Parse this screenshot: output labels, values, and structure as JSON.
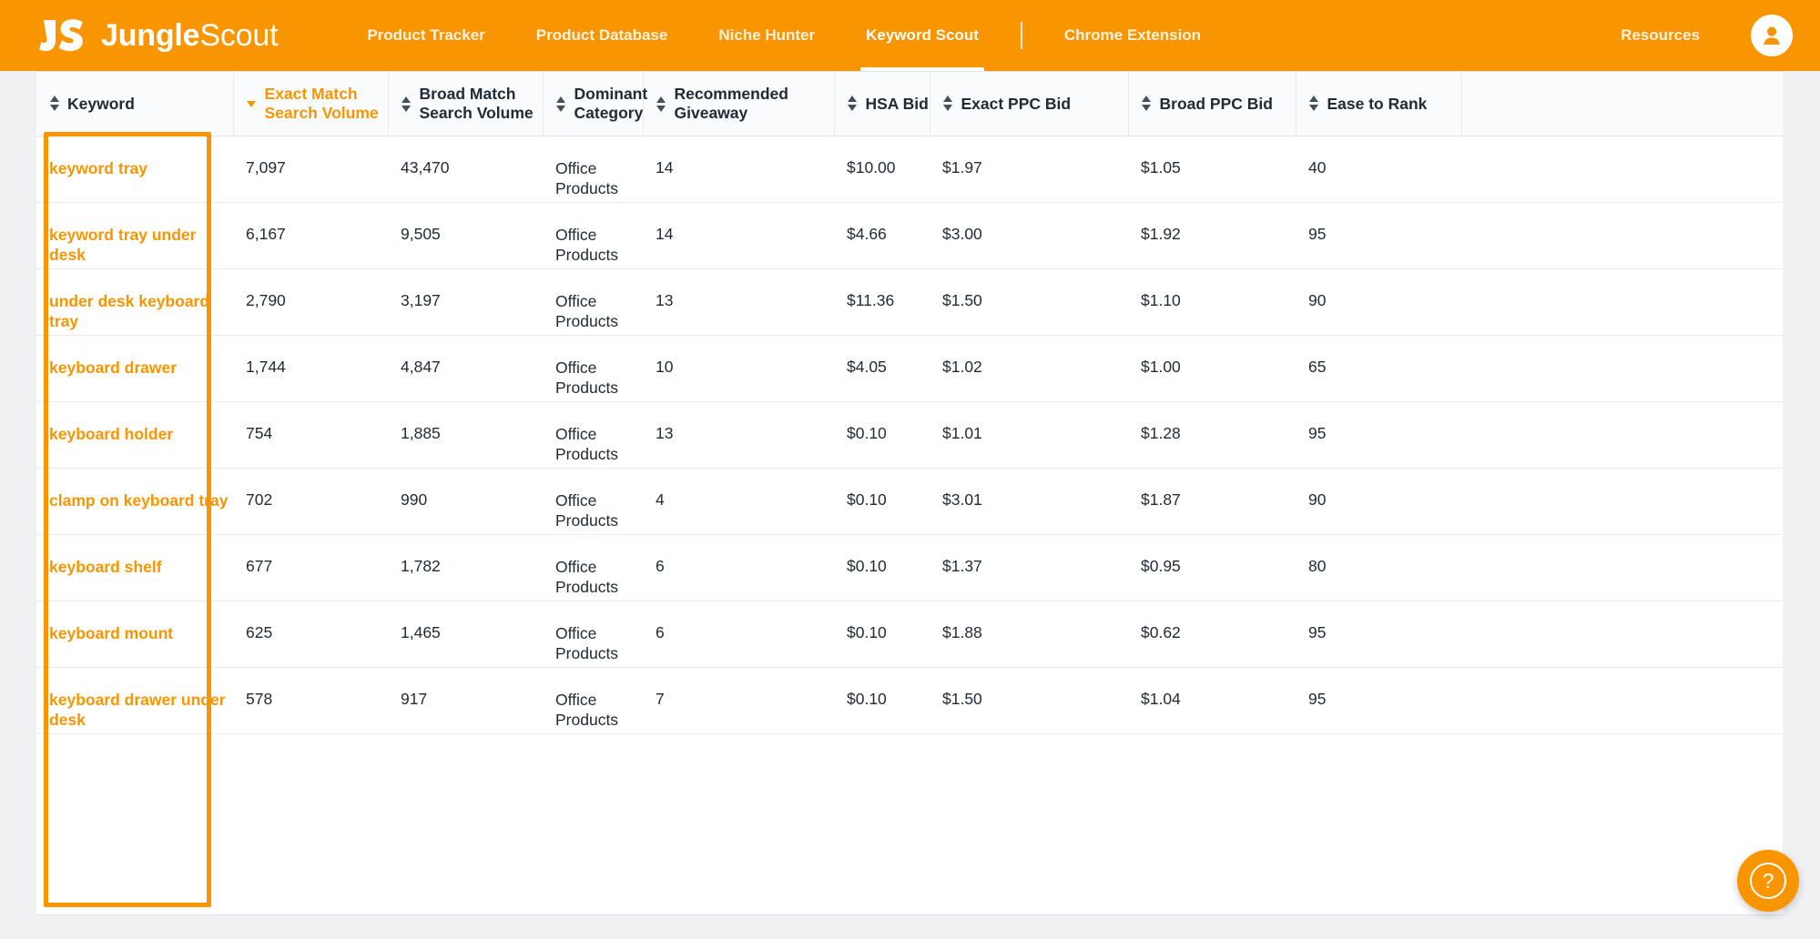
{
  "brand": {
    "mark": "JS",
    "name_bold": "Jungle",
    "name_light": "Scout"
  },
  "nav": {
    "links": [
      {
        "label": "Product Tracker",
        "active": false
      },
      {
        "label": "Product Database",
        "active": false
      },
      {
        "label": "Niche Hunter",
        "active": false
      },
      {
        "label": "Keyword Scout",
        "active": true
      },
      {
        "label": "Chrome Extension",
        "active": false
      }
    ],
    "resources_label": "Resources",
    "avatar_icon": "user-avatar-icon"
  },
  "table": {
    "columns": [
      {
        "label": "Keyword",
        "label_line2": "",
        "sorted": false,
        "sort_dir": ""
      },
      {
        "label": "Exact Match",
        "label_line2": "Search Volume",
        "sorted": true,
        "sort_dir": "desc"
      },
      {
        "label": "Broad Match",
        "label_line2": "Search Volume",
        "sorted": false,
        "sort_dir": ""
      },
      {
        "label": "Dominant",
        "label_line2": "Category",
        "sorted": false,
        "sort_dir": ""
      },
      {
        "label": "Recommended",
        "label_line2": "Giveaway",
        "sorted": false,
        "sort_dir": ""
      },
      {
        "label": "HSA Bid",
        "label_line2": "",
        "sorted": false,
        "sort_dir": ""
      },
      {
        "label": "Exact PPC Bid",
        "label_line2": "",
        "sorted": false,
        "sort_dir": ""
      },
      {
        "label": "Broad PPC Bid",
        "label_line2": "",
        "sorted": false,
        "sort_dir": ""
      },
      {
        "label": "Ease to Rank",
        "label_line2": "",
        "sorted": false,
        "sort_dir": ""
      }
    ],
    "rows": [
      {
        "keyword": "keyword tray",
        "exact": "7,097",
        "broad": "43,470",
        "category": "Office Products",
        "giveaway": "14",
        "hsa": "$10.00",
        "exact_ppc": "$1.97",
        "broad_ppc": "$1.05",
        "ease": "40"
      },
      {
        "keyword": "keyword tray under desk",
        "exact": "6,167",
        "broad": "9,505",
        "category": "Office Products",
        "giveaway": "14",
        "hsa": "$4.66",
        "exact_ppc": "$3.00",
        "broad_ppc": "$1.92",
        "ease": "95"
      },
      {
        "keyword": "under desk keyboard tray",
        "exact": "2,790",
        "broad": "3,197",
        "category": "Office Products",
        "giveaway": "13",
        "hsa": "$11.36",
        "exact_ppc": "$1.50",
        "broad_ppc": "$1.10",
        "ease": "90"
      },
      {
        "keyword": "keyboard drawer",
        "exact": "1,744",
        "broad": "4,847",
        "category": "Office Products",
        "giveaway": "10",
        "hsa": "$4.05",
        "exact_ppc": "$1.02",
        "broad_ppc": "$1.00",
        "ease": "65"
      },
      {
        "keyword": "keyboard holder",
        "exact": "754",
        "broad": "1,885",
        "category": "Office Products",
        "giveaway": "13",
        "hsa": "$0.10",
        "exact_ppc": "$1.01",
        "broad_ppc": "$1.28",
        "ease": "95"
      },
      {
        "keyword": "clamp on keyboard tray",
        "exact": "702",
        "broad": "990",
        "category": "Office Products",
        "giveaway": "4",
        "hsa": "$0.10",
        "exact_ppc": "$3.01",
        "broad_ppc": "$1.87",
        "ease": "90"
      },
      {
        "keyword": "keyboard shelf",
        "exact": "677",
        "broad": "1,782",
        "category": "Office Products",
        "giveaway": "6",
        "hsa": "$0.10",
        "exact_ppc": "$1.37",
        "broad_ppc": "$0.95",
        "ease": "80"
      },
      {
        "keyword": "keyboard mount",
        "exact": "625",
        "broad": "1,465",
        "category": "Office Products",
        "giveaway": "6",
        "hsa": "$0.10",
        "exact_ppc": "$1.88",
        "broad_ppc": "$0.62",
        "ease": "95"
      },
      {
        "keyword": "keyboard drawer under desk",
        "exact": "578",
        "broad": "917",
        "category": "Office Products",
        "giveaway": "7",
        "hsa": "$0.10",
        "exact_ppc": "$1.50",
        "broad_ppc": "$1.04",
        "ease": "95"
      }
    ]
  },
  "help": {
    "icon": "question-mark-icon",
    "label": "?"
  },
  "colors": {
    "brand_orange": "#f99500",
    "text_dark": "#212b36",
    "border": "#e8ebee",
    "page_bg": "#f0f1f3"
  }
}
